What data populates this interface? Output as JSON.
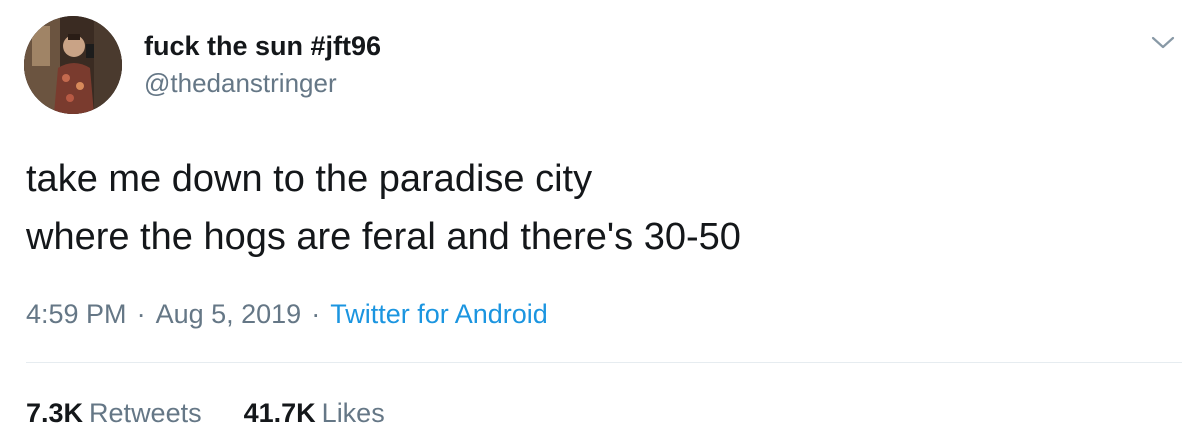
{
  "user": {
    "display_name": "fuck the sun #jft96",
    "handle": "@thedanstringer"
  },
  "tweet": {
    "lines": [
      "take me down to the paradise city",
      "where the hogs are feral and there's 30-50"
    ],
    "time": "4:59 PM",
    "date": "Aug 5, 2019",
    "separator": "·",
    "source": "Twitter for Android"
  },
  "stats": {
    "retweets_count": "7.3K",
    "retweets_label": "Retweets",
    "likes_count": "41.7K",
    "likes_label": "Likes"
  },
  "icons": {
    "menu": "chevron-down-icon"
  },
  "colors": {
    "text": "#14171a",
    "secondary": "#657786",
    "link": "#1b95e0",
    "divider": "#e6ecf0"
  }
}
